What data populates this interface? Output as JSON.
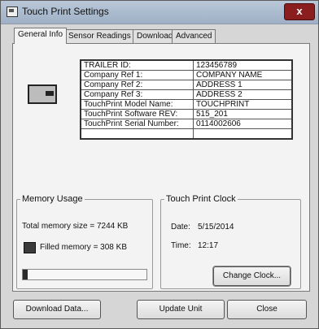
{
  "window": {
    "title": "Touch Print Settings",
    "close_glyph": "x"
  },
  "tabs": [
    {
      "label": "General Info",
      "active": true
    },
    {
      "label": "Sensor Readings",
      "active": false
    },
    {
      "label": "Download",
      "active": false
    },
    {
      "label": "Advanced",
      "active": false
    }
  ],
  "general_info": {
    "device_icon": "trailer-device-icon",
    "rows": [
      {
        "label": "TRAILER ID:",
        "value": "123456789"
      },
      {
        "label": "Company Ref 1:",
        "value": "COMPANY NAME"
      },
      {
        "label": "Company Ref 2:",
        "value": "ADDRESS 1"
      },
      {
        "label": "Company Ref 3:",
        "value": "ADDRESS 2"
      },
      {
        "label": "TouchPrint Model Name:",
        "value": "TOUCHPRINT"
      },
      {
        "label": "TouchPrint Software REV:",
        "value": "515_201"
      },
      {
        "label": "TouchPrint Serial Number:",
        "value": "0114002606"
      },
      {
        "label": "",
        "value": ""
      }
    ]
  },
  "memory_usage": {
    "legend": "Memory Usage",
    "total_text": "Total memory size = 7244 KB",
    "filled_text": "Filled memory = 308 KB",
    "filled_fraction": 0.0425
  },
  "clock": {
    "legend": "Touch Print Clock",
    "date_label": "Date:",
    "date_value": "5/15/2014",
    "time_label": "Time:",
    "time_value": "12:17",
    "change_button": "Change Clock..."
  },
  "footer": {
    "download_button": "Download Data...",
    "update_button": "Update Unit",
    "close_button": "Close"
  }
}
